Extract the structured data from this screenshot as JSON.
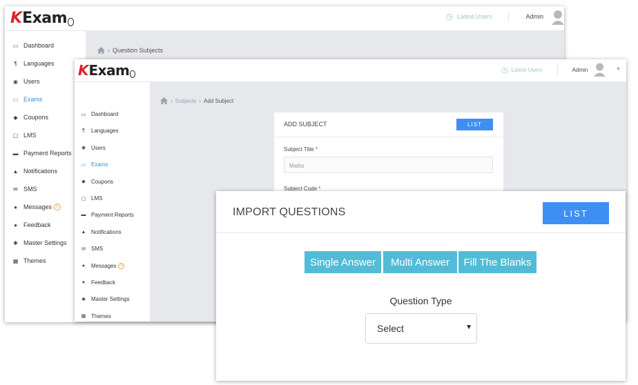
{
  "brand": {
    "letter": "K",
    "rest": "Exam"
  },
  "nav": [
    {
      "label": "Dashboard",
      "icon": "window-icon",
      "glyph": "▭"
    },
    {
      "label": "Languages",
      "icon": "translate-icon",
      "glyph": "¶"
    },
    {
      "label": "Users",
      "icon": "user-circle-icon",
      "glyph": "◉"
    },
    {
      "label": "Exams",
      "icon": "monitor-icon",
      "glyph": "▭"
    },
    {
      "label": "Coupons",
      "icon": "tag-icon",
      "glyph": "◆"
    },
    {
      "label": "LMS",
      "icon": "desktop-icon",
      "glyph": "▢"
    },
    {
      "label": "Payment Reports",
      "icon": "credit-card-icon",
      "glyph": "▬"
    },
    {
      "label": "Notifications",
      "icon": "bell-icon",
      "glyph": "▲"
    },
    {
      "label": "SMS",
      "icon": "envelope-icon",
      "glyph": "✉"
    },
    {
      "label": "Messages",
      "icon": "chat-bubbles-icon",
      "glyph": "●",
      "badge": "0"
    },
    {
      "label": "Feedback",
      "icon": "comment-icon",
      "glyph": "●"
    },
    {
      "label": "Master Settings",
      "icon": "gear-icon",
      "glyph": "✱"
    },
    {
      "label": "Themes",
      "icon": "grid-icon",
      "glyph": "▦"
    }
  ],
  "active_nav": "Exams",
  "topbar": {
    "latest_users": "Latest Users",
    "admin": "Admin",
    "clock_glyph": "◷"
  },
  "win1": {
    "breadcrumb": "Question Subjects"
  },
  "win2": {
    "breadcrumb_link": "Subjects",
    "breadcrumb_current": "Add Subject",
    "panel_title": "ADD SUBJECT",
    "list_button": "LIST",
    "field1_label": "Subject Title",
    "field1_value": "Maths",
    "field2_label": "Subject Code",
    "required": "*"
  },
  "win3": {
    "title": "IMPORT QUESTIONS",
    "list_button": "LIST",
    "tabs": [
      "Single Answer",
      "Multi Answer",
      "Fill The Blanks"
    ],
    "question_type_label": "Question Type",
    "select_value": "Select"
  },
  "colors": {
    "accent": "#3f8ef2",
    "tab": "#52bcd8",
    "brand_red": "#d9262c",
    "content_bg": "#e6e8ec"
  }
}
